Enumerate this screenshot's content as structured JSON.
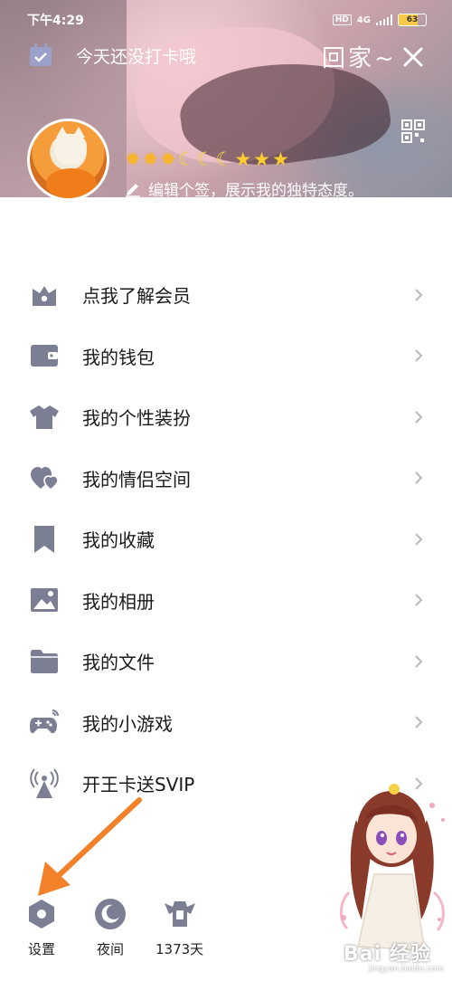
{
  "status_bar": {
    "time": "下午4:29",
    "hd": "HD",
    "network": "4G",
    "battery": "63"
  },
  "header": {
    "checkin_text": "今天还没打卡哦",
    "handwriting": "回家~",
    "level_icons": {
      "suns": 3,
      "moons": 3,
      "stars": 3,
      "sun_glyph": "✹",
      "moon_glyph": "☾",
      "star_glyph": "★"
    },
    "signature": "编辑个签，展示我的独特态度。"
  },
  "menu": [
    {
      "label": "点我了解会员",
      "icon": "crown-icon"
    },
    {
      "label": "我的钱包",
      "icon": "wallet-icon"
    },
    {
      "label": "我的个性装扮",
      "icon": "shirt-icon"
    },
    {
      "label": "我的情侣空间",
      "icon": "hearts-icon"
    },
    {
      "label": "我的收藏",
      "icon": "bookmark-icon"
    },
    {
      "label": "我的相册",
      "icon": "photo-icon"
    },
    {
      "label": "我的文件",
      "icon": "folder-icon"
    },
    {
      "label": "我的小游戏",
      "icon": "gamepad-icon"
    },
    {
      "label": "开王卡送SVIP",
      "icon": "antenna-icon"
    }
  ],
  "bottom": {
    "settings": "设置",
    "night": "夜间",
    "days": "1373天"
  },
  "watermark": {
    "main": "Bai 经验",
    "sub": "jingyan.baidu.com"
  },
  "colors": {
    "icon_gray": "#7c7f93",
    "chevron": "#b8b8b8",
    "arrow": "#f2812a"
  }
}
